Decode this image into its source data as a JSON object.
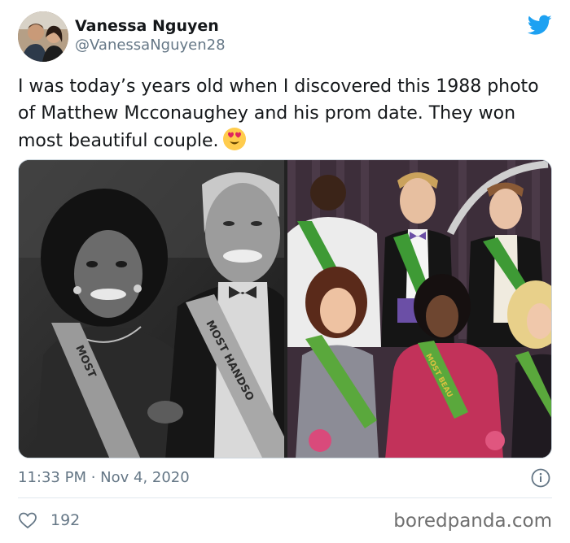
{
  "author": {
    "display_name": "Vanessa Nguyen",
    "handle": "@VanessaNguyen28"
  },
  "tweet": {
    "text": "I was today’s years old when I discovered this 1988 photo of Matthew Mcconaughey and his prom date. They won most beautiful couple."
  },
  "media": {
    "left_photo": {
      "sash_text_1": "MOST",
      "sash_text_2": "MOST HANDSO"
    },
    "right_photo": {
      "sash_text": "MOST BEAU"
    }
  },
  "meta": {
    "timestamp": "11:33 PM · Nov 4, 2020"
  },
  "footer": {
    "like_count": "192",
    "watermark": "boredpanda.com"
  },
  "colors": {
    "brand": "#1DA1F2",
    "text": "#14171a",
    "muted": "#657786",
    "sash": "#3e9a35"
  },
  "icons": [
    "twitter-bird-icon",
    "info-icon",
    "heart-icon",
    "heart-eyes-emoji"
  ]
}
